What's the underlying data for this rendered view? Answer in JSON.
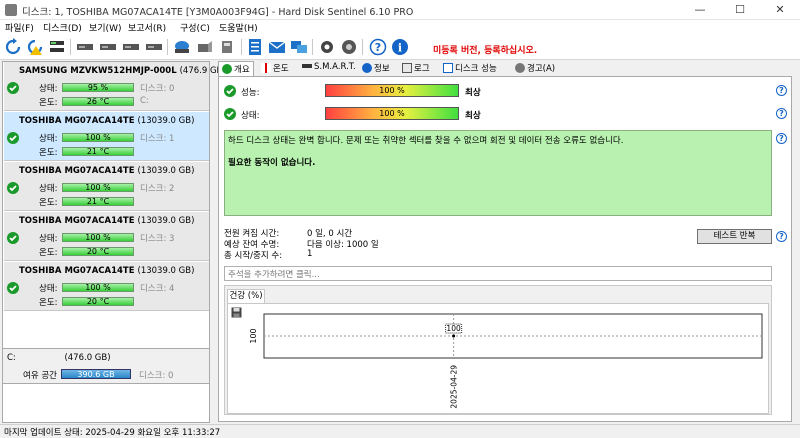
{
  "window": {
    "title": "디스크: 1, TOSHIBA MG07ACA14TE [Y3M0A003F94G]  -  Hard Disk Sentinel 6.10 PRO",
    "min": "—",
    "max": "☐",
    "close": "✕"
  },
  "menu": [
    "파일(F)",
    "디스크(D)",
    "보기(W)",
    "보고서(R)",
    "구성(C)",
    "도움말(H)"
  ],
  "toolbar": {
    "icons": [
      "refresh-icon",
      "refresh-warning-icon",
      "disk-list-icon",
      "disk-icon",
      "disk-icon",
      "disk-icon",
      "disk-icon",
      "drive-icon",
      "drive-icon",
      "drive-icon",
      "report-icon",
      "email-icon",
      "network-icon",
      "settings-icon",
      "sound-icon",
      "help-icon",
      "info-icon"
    ],
    "promo": "미등록 버전, 등록하십시오."
  },
  "disks": [
    {
      "name": "SAMSUNG MZVKW512HMJP-000L",
      "size": "(476.9 GB)",
      "health_label": "상태:",
      "health": "95 %",
      "temp_label": "온도:",
      "temp": "26 °C",
      "side1": "디스크: 0",
      "side2": "C:",
      "selected": false
    },
    {
      "name": "TOSHIBA MG07ACA14TE",
      "size": "(13039.0 GB)",
      "health_label": "상태:",
      "health": "100 %",
      "temp_label": "온도:",
      "temp": "21 °C",
      "side1": "디스크: 1",
      "side2": "",
      "selected": true
    },
    {
      "name": "TOSHIBA MG07ACA14TE",
      "size": "(13039.0 GB)",
      "health_label": "상태:",
      "health": "100 %",
      "temp_label": "온도:",
      "temp": "21 °C",
      "side1": "디스크: 2",
      "side2": "",
      "selected": false
    },
    {
      "name": "TOSHIBA MG07ACA14TE",
      "size": "(13039.0 GB)",
      "health_label": "상태:",
      "health": "100 %",
      "temp_label": "온도:",
      "temp": "20 °C",
      "side1": "디스크: 3",
      "side2": "",
      "selected": false
    },
    {
      "name": "TOSHIBA MG07ACA14TE",
      "size": "(13039.0 GB)",
      "health_label": "상태:",
      "health": "100 %",
      "temp_label": "온도:",
      "temp": "20 °C",
      "side1": "디스크: 4",
      "side2": "",
      "selected": false
    }
  ],
  "volume": {
    "drive": "C:",
    "size": "(476.0 GB)",
    "free_label": "여유 공간",
    "free": "390.6 GB",
    "disk": "디스크: 0"
  },
  "tabs": [
    {
      "label": "개요",
      "icon": "overview-icon",
      "active": true
    },
    {
      "label": "온도",
      "icon": "thermometer-icon",
      "active": false
    },
    {
      "label": "S.M.A.R.T.",
      "icon": "smart-icon",
      "active": false
    },
    {
      "label": "정보",
      "icon": "info-icon",
      "active": false
    },
    {
      "label": "로그",
      "icon": "log-icon",
      "active": false
    },
    {
      "label": "디스크 성능",
      "icon": "performance-icon",
      "active": false
    },
    {
      "label": "경고(A)",
      "icon": "alert-icon",
      "active": false
    }
  ],
  "overview": {
    "performance_label": "성능:",
    "performance": "100 %",
    "performance_rating": "최상",
    "health_label": "상태:",
    "health": "100 %",
    "health_rating": "최상",
    "status_text": "하드 디스크 상태는 완벽 합니다. 문제 또는 취약한 섹터를 찾을 수 없으며 회전 및 데이터 전송 오류도 없습니다.",
    "action_text": "필요한 동작이 없습니다.",
    "power_on_label": "전원 켜짐 시간:",
    "power_on": "0 일, 0 시간",
    "lifetime_label": "예상 잔여 수명:",
    "lifetime": "다음 이상: 1000 일",
    "starts_label": "총 시작/중지 수:",
    "starts": "1",
    "repeat_button": "테스트 반복",
    "comment_placeholder": "주석을 추가하려면 클릭...",
    "health_tab": "건강 (%)"
  },
  "chart_data": {
    "type": "line",
    "x": [
      "2025-04-29"
    ],
    "series": [
      {
        "values": [
          100
        ]
      }
    ],
    "ylabel": "",
    "yticks": [
      "100"
    ],
    "point_label": "100"
  },
  "statusbar": {
    "text": "마지막 업데이트 상태: 2025-04-29 화요일 오후 11:33:27"
  },
  "colors": {
    "ok_green": "#1a9a2a",
    "bar_green": "#38d038",
    "selected": "#cde8ff",
    "status_box": "#b9f2b0",
    "promo": "#e00000"
  }
}
